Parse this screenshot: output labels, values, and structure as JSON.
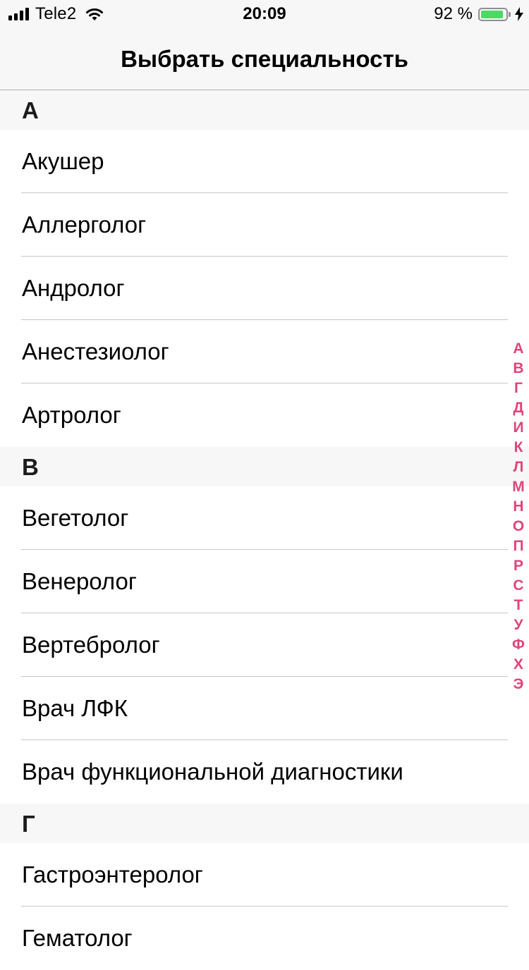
{
  "status_bar": {
    "carrier": "Tele2",
    "time": "20:09",
    "battery_percent": "92 %",
    "battery_level": 0.92,
    "battery_color": "#4cd964",
    "icons": [
      "signal-icon",
      "wifi-icon",
      "battery-icon",
      "charging-bolt-icon"
    ]
  },
  "nav": {
    "title": "Выбрать специальность"
  },
  "sections": [
    {
      "header": "А",
      "items": [
        "Акушер",
        "Аллерголог",
        "Андролог",
        "Анестезиолог",
        "Артролог"
      ]
    },
    {
      "header": "В",
      "items": [
        "Вегетолог",
        "Венеролог",
        "Вертебролог",
        "Врач ЛФК",
        "Врач функциональной диагностики"
      ]
    },
    {
      "header": "Г",
      "items": [
        "Гастроэнтеролог",
        "Гематолог"
      ]
    }
  ],
  "index": [
    "А",
    "В",
    "Г",
    "Д",
    "И",
    "К",
    "Л",
    "М",
    "Н",
    "О",
    "П",
    "Р",
    "С",
    "Т",
    "У",
    "Ф",
    "Х",
    "Э"
  ],
  "colors": {
    "index_accent": "#e0447a"
  }
}
